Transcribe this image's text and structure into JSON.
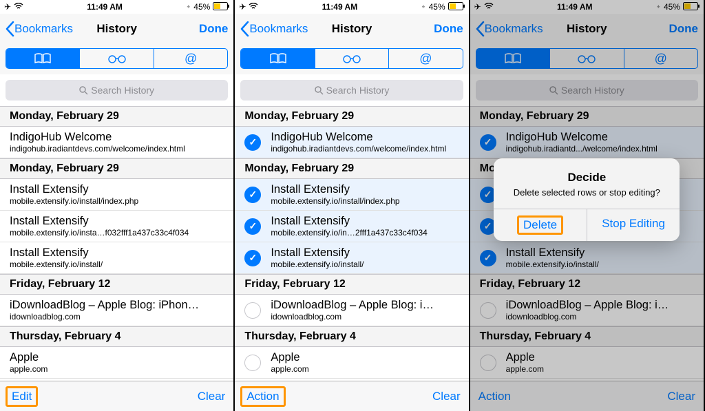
{
  "status": {
    "time": "11:49 AM",
    "bluetooth": "45%"
  },
  "nav": {
    "back": "Bookmarks",
    "title": "History",
    "done": "Done"
  },
  "search": {
    "placeholder": "Search History"
  },
  "sections": [
    {
      "label": "Monday, February 29",
      "rows": [
        {
          "title": "IndigoHub Welcome",
          "sub1": "indigohub.iradiantdevs.com/welcome/index.html",
          "sub2": "indigohub.iradiantdevs.com/welcome/index.html",
          "sub3": "indigohub.iradiantd.../welcome/index.html"
        }
      ]
    },
    {
      "label": "Monday, February 29",
      "rows": [
        {
          "title": "Install Extensify",
          "sub1": "mobile.extensify.io/install/index.php",
          "sub2": "mobile.extensify.io/install/index.php",
          "sub3": ""
        },
        {
          "title": "Install Extensify",
          "sub1": "mobile.extensify.io/insta…f032fff1a437c33c4f034",
          "sub2": "mobile.extensify.io/in…2fff1a437c33c4f034",
          "sub3": ""
        },
        {
          "title": "Install Extensify",
          "sub1": "mobile.extensify.io/install/",
          "sub2": "mobile.extensify.io/install/",
          "sub3": "mobile.extensify.io/install/"
        }
      ]
    },
    {
      "label": "Friday, February 12",
      "rows": [
        {
          "title1": "iDownloadBlog – Apple Blog: iPhon…",
          "title2": "iDownloadBlog – Apple Blog: i…",
          "title3": "iDownloadBlog – Apple Blog: i…",
          "sub": "idownloadblog.com"
        }
      ]
    },
    {
      "label": "Thursday, February 4",
      "rows": [
        {
          "title": "Apple",
          "sub": "apple.com"
        }
      ]
    }
  ],
  "toolbar": {
    "edit": "Edit",
    "action": "Action",
    "clear": "Clear"
  },
  "alert": {
    "title": "Decide",
    "msg": "Delete selected rows or stop editing?",
    "delete": "Delete",
    "stop": "Stop Editing"
  }
}
